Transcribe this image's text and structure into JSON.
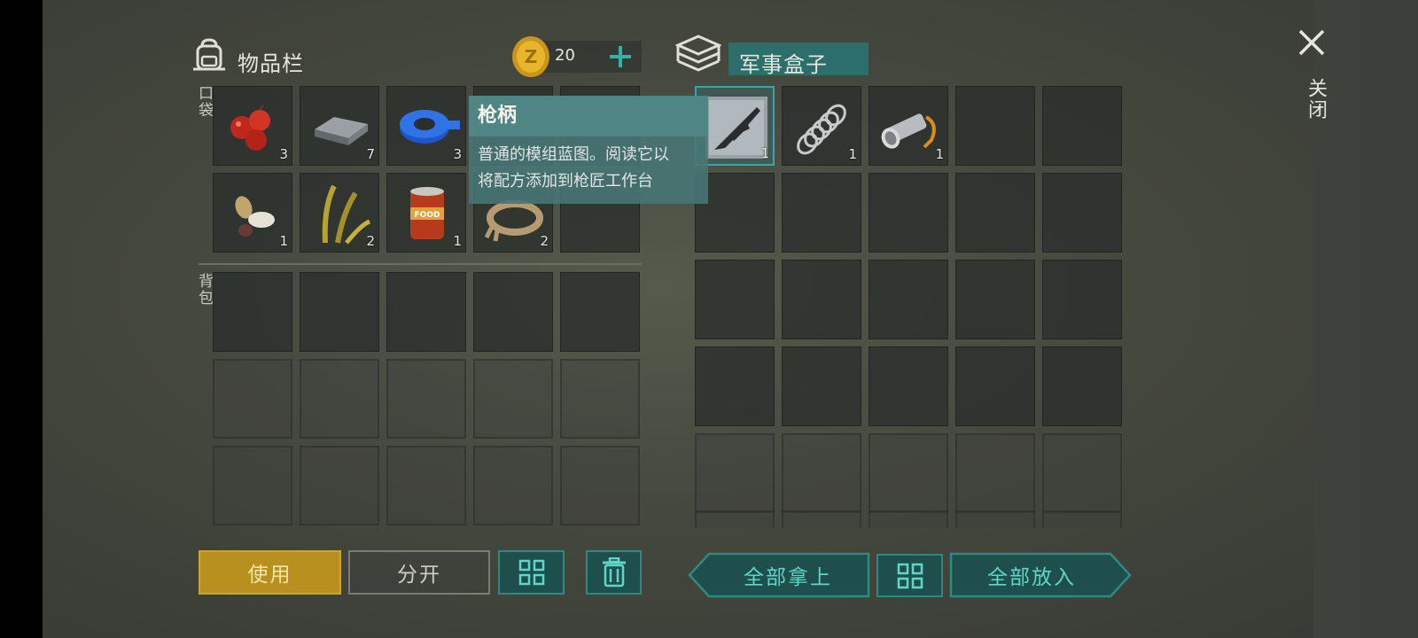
{
  "inventory": {
    "title": "物品栏",
    "currency_amount": "20",
    "pocket_label": "口袋",
    "backpack_label": "背包",
    "pocket_items": [
      {
        "icon": "berries-icon",
        "qty": "3"
      },
      {
        "icon": "metal-ingot-icon",
        "qty": "7"
      },
      {
        "icon": "blue-tape-icon",
        "qty": "3"
      },
      {
        "icon": "",
        "qty": ""
      },
      {
        "icon": "",
        "qty": ""
      },
      {
        "icon": "seeds-icon",
        "qty": "1"
      },
      {
        "icon": "plant-fiber-icon",
        "qty": "2"
      },
      {
        "icon": "canned-food-icon",
        "qty": "1"
      },
      {
        "icon": "rope-icon",
        "qty": "2"
      },
      {
        "icon": "",
        "qty": ""
      }
    ]
  },
  "container": {
    "title": "军事盒子",
    "items": [
      {
        "icon": "rifle-blueprint-icon",
        "qty": "1"
      },
      {
        "icon": "spring-icon",
        "qty": "1"
      },
      {
        "icon": "flashlight-icon",
        "qty": "1"
      }
    ]
  },
  "tooltip": {
    "title": "枪柄",
    "description_line1": "普通的模组蓝图。阅读它以",
    "description_line2": "将配方添加到枪匠工作台"
  },
  "buttons": {
    "use": "使用",
    "split": "分开",
    "take_all": "全部拿上",
    "put_all": "全部放入"
  },
  "close_label": "关闭",
  "colors": {
    "accent_teal": "#2c8a83",
    "use_button": "#b8901f",
    "tooltip_bg": "#4f8585"
  }
}
